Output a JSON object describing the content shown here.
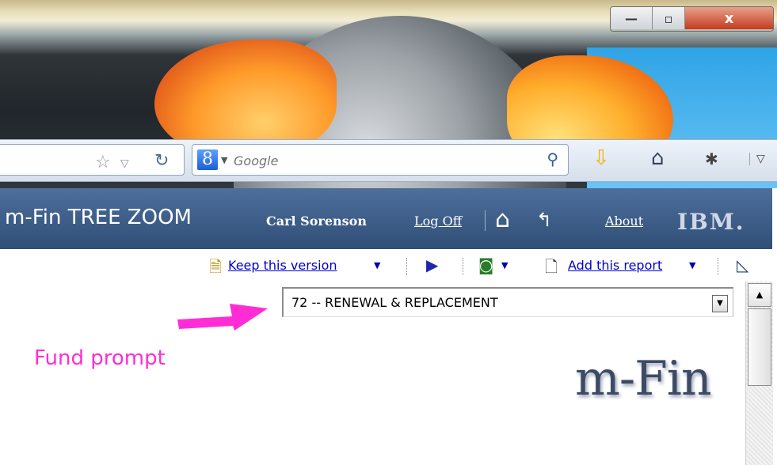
{
  "browser": {
    "window_buttons": {
      "minimize": "—",
      "maximize": "▫",
      "close": "x"
    },
    "search": {
      "placeholder": "Google",
      "engine_badge": "8"
    }
  },
  "app": {
    "title": "m-Fin TREE ZOOM",
    "user_name": "Carl Sorenson",
    "logoff_label": "Log Off",
    "about_label": "About",
    "brand": "IBM."
  },
  "toolbar": {
    "keep_version_label": "Keep this version",
    "add_report_label": "Add this report"
  },
  "prompt": {
    "selected_value": "72 -- RENEWAL & REPLACEMENT"
  },
  "annotation": {
    "label": "Fund prompt",
    "color": "#ff2dd6"
  },
  "logo": {
    "text": "m-Fin"
  },
  "colors": {
    "header_bg": "#3d5d88",
    "link": "#0000cc"
  }
}
